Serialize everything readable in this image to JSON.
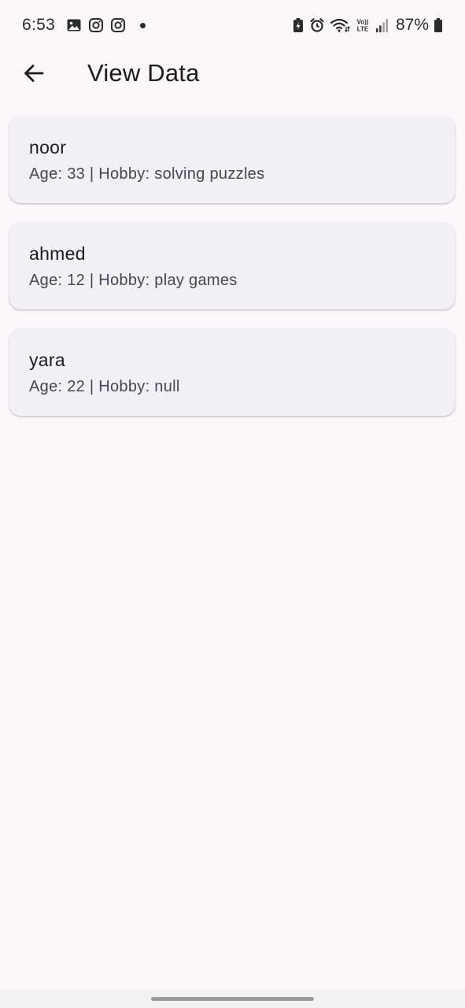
{
  "status_bar": {
    "time": "6:53",
    "battery_percent": "87%",
    "left_icons": [
      "gallery-icon",
      "instagram-icon",
      "instagram-icon",
      "notification-dot"
    ],
    "right_icons": [
      "battery-saver-icon",
      "alarm-icon",
      "wifi-icon",
      "volte-icon",
      "signal-icon",
      "battery-icon"
    ],
    "volte_label": "VoLTE"
  },
  "app_bar": {
    "title": "View Data",
    "back_icon": "arrow-left-icon"
  },
  "records": [
    {
      "name": "noor",
      "details": "Age: 33 | Hobby: solving puzzles"
    },
    {
      "name": "ahmed",
      "details": "Age: 12 | Hobby: play games"
    },
    {
      "name": "yara",
      "details": "Age: 22 | Hobby: null"
    }
  ],
  "colors": {
    "background": "#fdf7fd",
    "card": "#f3eff6",
    "title_text": "#1d1b20",
    "subtitle_text": "#49454f"
  }
}
